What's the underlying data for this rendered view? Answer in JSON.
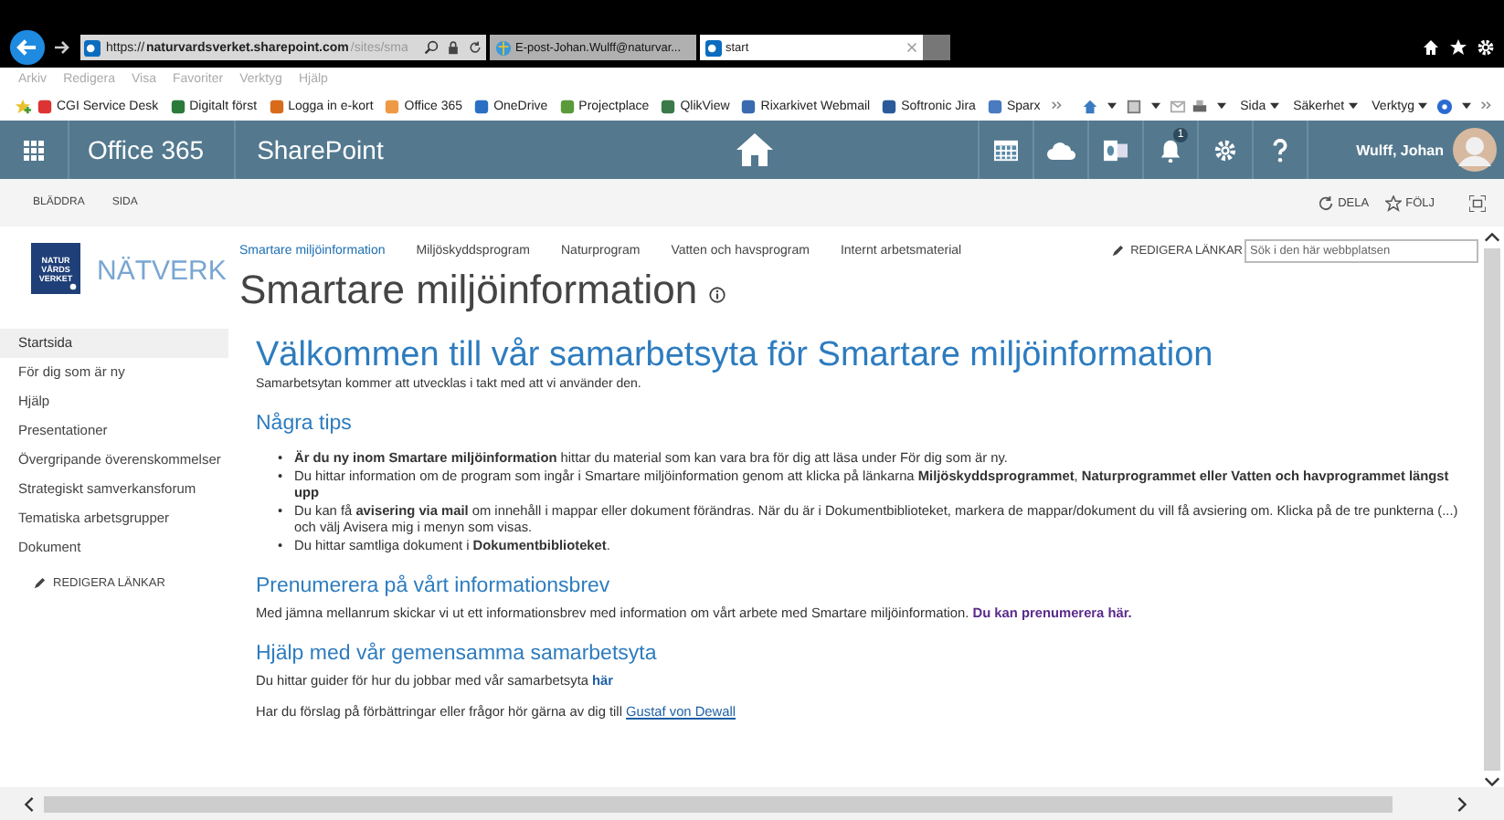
{
  "browser": {
    "address": {
      "scheme": "https://",
      "host": "naturvardsverket.sharepoint.com",
      "path": "/sites/sma"
    },
    "tabs": [
      {
        "label": "E-post-Johan.Wulff@naturvar...",
        "selected": false
      },
      {
        "label": "start",
        "selected": true
      }
    ],
    "menu": [
      "Arkiv",
      "Redigera",
      "Visa",
      "Favoriter",
      "Verktyg",
      "Hjälp"
    ],
    "favorites": [
      "CGI Service Desk",
      "Digitalt först",
      "Logga in e-kort",
      "Office 365",
      "OneDrive",
      "Projectplace",
      "QlikView",
      "Rixarkivet Webmail",
      "Softronic Jira",
      "Sparx"
    ],
    "commands": [
      "Sida",
      "Säkerhet",
      "Verktyg"
    ]
  },
  "suite_bar": {
    "brand": "Office 365",
    "app": "SharePoint",
    "notification_count": "1",
    "user": "Wulff, Johan"
  },
  "ribbon": {
    "tabs": [
      "BLÄDDRA",
      "SIDA"
    ],
    "actions": [
      "DELA",
      "FÖLJ"
    ]
  },
  "site": {
    "logo": [
      "NATUR",
      "VÅRDS",
      "VERKET"
    ],
    "name": "NÄTVERK",
    "top_nav": [
      {
        "label": "Smartare miljöinformation",
        "selected": true
      },
      {
        "label": "Miljöskyddsprogram",
        "selected": false
      },
      {
        "label": "Naturprogram",
        "selected": false
      },
      {
        "label": "Vatten och havsprogram",
        "selected": false
      },
      {
        "label": "Internt arbetsmaterial",
        "selected": false
      }
    ],
    "edit_links": "REDIGERA LÄNKAR",
    "search": {
      "placeholder": "Sök i den här webbplatsen"
    },
    "page_title": "Smartare miljöinformation"
  },
  "left_nav": {
    "items": [
      {
        "label": "Startsida",
        "selected": true
      },
      {
        "label": "För dig som är ny",
        "selected": false
      },
      {
        "label": "Hjälp",
        "selected": false
      },
      {
        "label": "Presentationer",
        "selected": false
      },
      {
        "label": "Övergripande överenskommelser",
        "selected": false
      },
      {
        "label": "Strategiskt samverkansforum",
        "selected": false
      },
      {
        "label": "Tematiska arbetsgrupper",
        "selected": false
      },
      {
        "label": "Dokument",
        "selected": false
      }
    ],
    "edit_links": "REDIGERA LÄNKAR"
  },
  "content": {
    "title": "Välkommen till vår samarbetsyta för Smartare miljöinformation",
    "intro": "Samarbetsytan kommer att utvecklas i takt med att vi använder den.",
    "sections": [
      {
        "heading": "Några tips",
        "kind": "bullets",
        "marker": "•",
        "bullets": [
          "**Är du ny inom Smartare miljöinformation** hittar du material som kan vara bra för dig att läsa under För dig som är ny.",
          "Du hittar information om de program som ingår i Smartare miljöinformation genom att klicka på länkarna **Miljöskyddsprogrammet**, **Naturprogrammet eller Vatten och havprogrammet längst upp**",
          "Du kan få **avisering via mail** om innehåll i mappar eller dokument förändras. När du är i Dokumentbiblioteket, markera de mappar/dokument du vill få avsiering om. Klicka på de tre punkterna (...) och välj Avisera mig i menyn som visas.",
          "Du hittar samtliga dokument i **Dokumentbiblioteket**."
        ]
      },
      {
        "heading": "Prenumerera på vårt informationsbrev",
        "kind": "paragraphs",
        "paragraphs": [
          {
            "text": "Med jämna mellanrum skickar vi ut ett informationsbrev med information om vårt arbete med Smartare miljöinformation.",
            "link": "Du kan prenumerera här.",
            "kind": "visited_link"
          }
        ]
      },
      {
        "heading": "Hjälp med vår gemensamma samarbetsyta",
        "kind": "paragraphs",
        "paragraphs": [
          {
            "text": "Du hittar guider för hur du jobbar med vår samarbetsyta",
            "link": "här",
            "kind": "bold_link"
          },
          {
            "text": "Har du förslag på förbättringar eller frågor hör gärna av dig till",
            "link": "Gustaf von Dewall",
            "kind": "underlined_link"
          }
        ]
      }
    ]
  }
}
